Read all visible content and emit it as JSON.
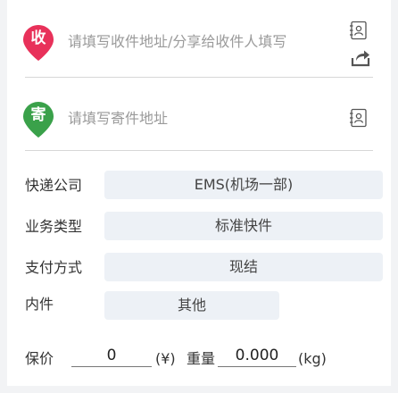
{
  "receiver": {
    "badge": "收",
    "placeholder": "请填写收件地址/分享给收件人填写"
  },
  "sender": {
    "badge": "寄",
    "placeholder": "请填写寄件地址"
  },
  "fields": {
    "courier": {
      "label": "快递公司",
      "value": "EMS(机场一部)"
    },
    "service_type": {
      "label": "业务类型",
      "value": "标准快件"
    },
    "payment": {
      "label": "支付方式",
      "value": "现结"
    },
    "contents": {
      "label": "内件",
      "value": "其他"
    }
  },
  "valuation": {
    "label": "保价",
    "value": "0",
    "unit": "(¥)"
  },
  "weight": {
    "label": "重量",
    "value": "0.000",
    "unit": "(kg)"
  },
  "colors": {
    "receiver_pin": "#e8315a",
    "sender_pin": "#3aa14a",
    "pill_bg": "#edf1f6",
    "background": "#f2f3f5"
  },
  "icons": [
    "address-book-icon",
    "share-icon",
    "address-book-icon"
  ]
}
